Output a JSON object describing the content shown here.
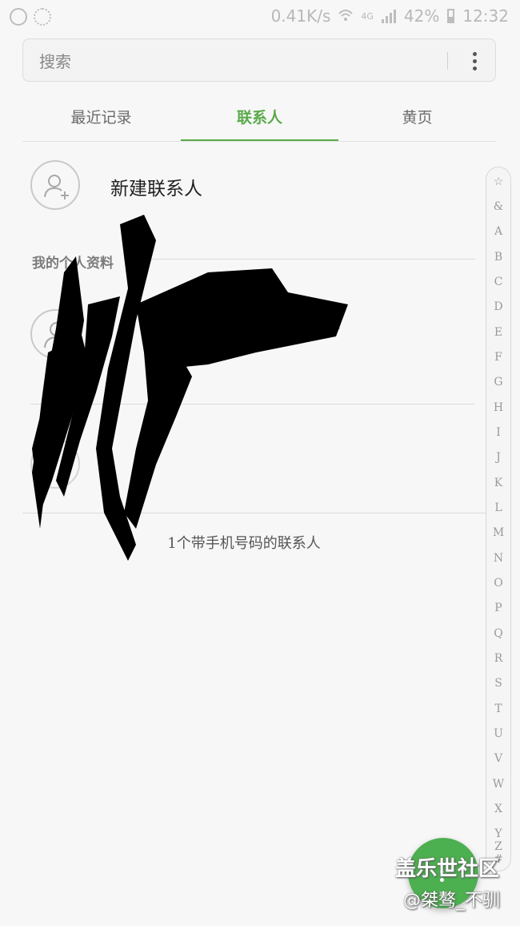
{
  "status_bar": {
    "speed": "0.41K/s",
    "network": "4G",
    "battery": "42%",
    "time": "12:32"
  },
  "search": {
    "placeholder": "搜索"
  },
  "tabs": [
    {
      "label": "最近记录",
      "active": false
    },
    {
      "label": "联系人",
      "active": true
    },
    {
      "label": "黄页",
      "active": false
    }
  ],
  "new_contact": {
    "label": "新建联系人"
  },
  "profile": {
    "section_title": "我的个人资料"
  },
  "contacts_summary": "1个带手机号码的联系人",
  "index_letters": [
    "☆",
    "&",
    "A",
    "B",
    "C",
    "D",
    "E",
    "F",
    "G",
    "H",
    "I",
    "J",
    "K",
    "L",
    "M",
    "N",
    "O",
    "P",
    "Q",
    "R",
    "S",
    "T",
    "U",
    "V",
    "W",
    "X",
    "Y",
    "Z",
    "#"
  ],
  "watermark": {
    "line1": "盖乐世社区",
    "line2": "@桀骜_不驯"
  },
  "colors": {
    "accent": "#5aaa4a",
    "fab": "#4caf50"
  }
}
